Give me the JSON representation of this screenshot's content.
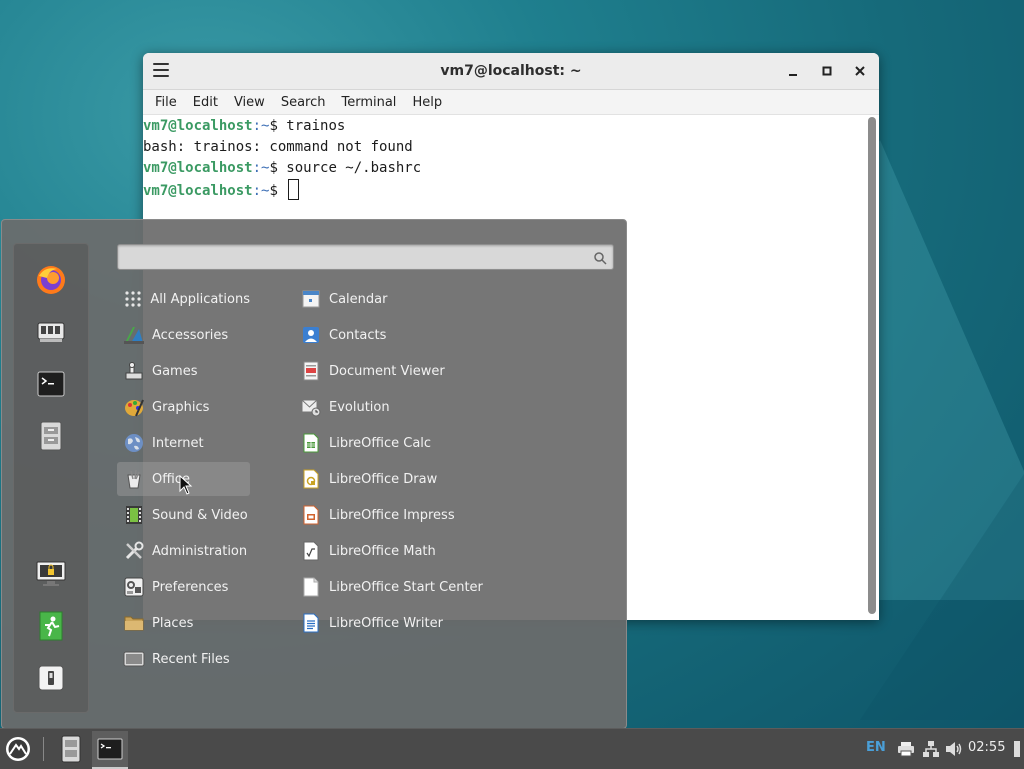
{
  "terminal": {
    "title": "vm7@localhost: ~",
    "menu": [
      "File",
      "Edit",
      "View",
      "Search",
      "Terminal",
      "Help"
    ],
    "lines": [
      {
        "user": "vm7@localhost",
        "path": ":~",
        "rest": "$ trainos"
      },
      {
        "text": "bash: trainos: command not found"
      },
      {
        "user": "vm7@localhost",
        "path": ":~",
        "rest": "$ source ~/.bashrc"
      },
      {
        "user": "vm7@localhost",
        "path": ":~",
        "rest": "$ "
      }
    ],
    "controls": {
      "minimize": "–",
      "maximize": "□",
      "close": "✕"
    }
  },
  "menu": {
    "search": {
      "value": "",
      "placeholder": ""
    },
    "categories": [
      {
        "label": "All Applications",
        "icon": "grid-icon"
      },
      {
        "label": "Accessories",
        "icon": "accessories-icon"
      },
      {
        "label": "Games",
        "icon": "games-icon"
      },
      {
        "label": "Graphics",
        "icon": "graphics-icon"
      },
      {
        "label": "Internet",
        "icon": "globe-icon"
      },
      {
        "label": "Office",
        "icon": "office-icon"
      },
      {
        "label": "Sound & Video",
        "icon": "film-icon"
      },
      {
        "label": "Administration",
        "icon": "tools-icon"
      },
      {
        "label": "Preferences",
        "icon": "preferences-icon"
      },
      {
        "label": "Places",
        "icon": "folder-icon"
      },
      {
        "label": "Recent Files",
        "icon": "recent-files-icon"
      }
    ],
    "active_category": "Office",
    "apps": [
      {
        "label": "Calendar",
        "icon": "calendar-icon"
      },
      {
        "label": "Contacts",
        "icon": "contacts-icon"
      },
      {
        "label": "Document Viewer",
        "icon": "document-viewer-icon"
      },
      {
        "label": "Evolution",
        "icon": "evolution-icon"
      },
      {
        "label": "LibreOffice Calc",
        "icon": "libreoffice-calc-icon"
      },
      {
        "label": "LibreOffice Draw",
        "icon": "libreoffice-draw-icon"
      },
      {
        "label": "LibreOffice Impress",
        "icon": "libreoffice-impress-icon"
      },
      {
        "label": "LibreOffice Math",
        "icon": "libreoffice-math-icon"
      },
      {
        "label": "LibreOffice Start Center",
        "icon": "libreoffice-start-icon"
      },
      {
        "label": "LibreOffice Writer",
        "icon": "libreoffice-writer-icon"
      }
    ],
    "favorites": [
      "firefox-icon",
      "software-manager-icon",
      "terminal-icon",
      "files-icon",
      "lock-screen-icon",
      "logout-icon",
      "shutdown-icon"
    ]
  },
  "panel": {
    "keyboard_layout": "EN",
    "clock": "02:55",
    "tray_icons": [
      "printer-icon",
      "network-icon",
      "volume-icon",
      "notifications-icon"
    ]
  },
  "colors": {
    "prompt_user": "#3b9a63",
    "prompt_path": "#3d6fb6",
    "keyboard_layout": "#4a9fd8"
  }
}
